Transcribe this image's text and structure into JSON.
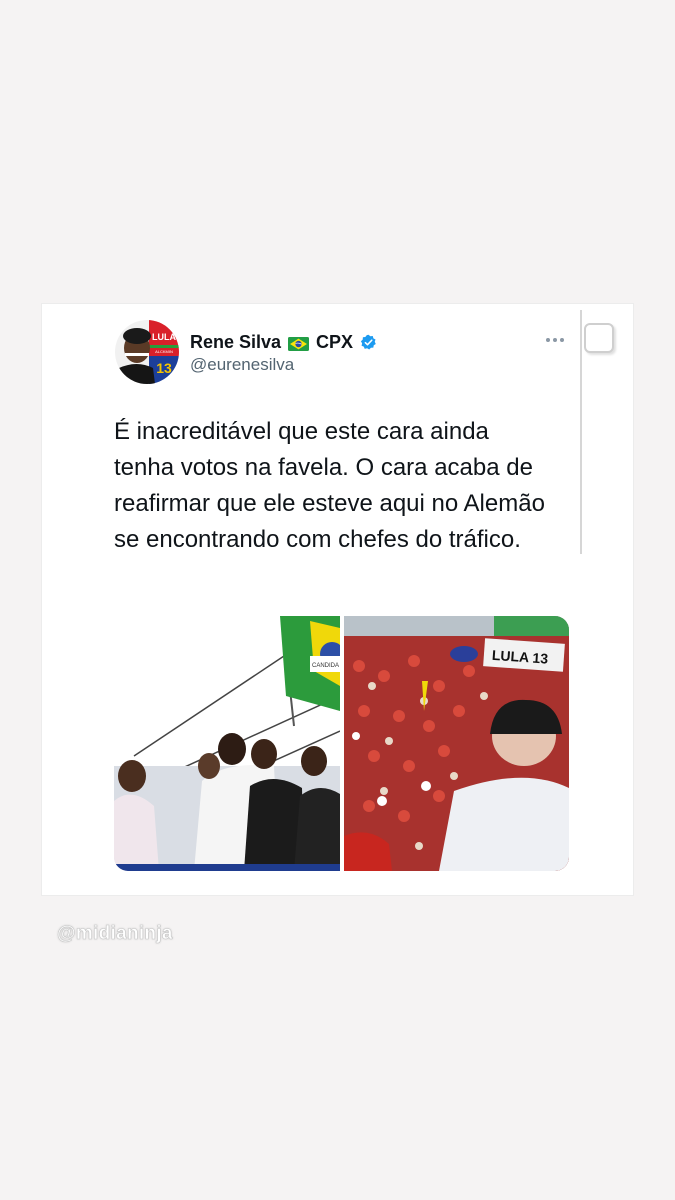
{
  "tweet": {
    "display_name": "Rene Silva",
    "name_suffix": "CPX",
    "handle": "@eurenesilva",
    "text": "É inacreditável que este cara ainda tenha votos na favela. O cara acaba de reafirmar que ele esteve aqui no Alemão se encontrando com chefes do tráfico.",
    "avatar_badge": {
      "top": "LULA",
      "middle": "ALCKMIN",
      "number": "13"
    },
    "media": {
      "left_banner_text": "CANDIDA",
      "right_banner_text": "LULA 13"
    }
  },
  "watermark": "@midianinja",
  "colors": {
    "page_background": "#f5f3f3",
    "card_background": "#ffffff",
    "text_primary": "#0f1419",
    "text_secondary": "#536471",
    "verified_blue": "#1d9bf0"
  },
  "icons": [
    "brazil-flag-icon",
    "verified-badge-icon",
    "more-options-icon",
    "share-square-icon"
  ]
}
